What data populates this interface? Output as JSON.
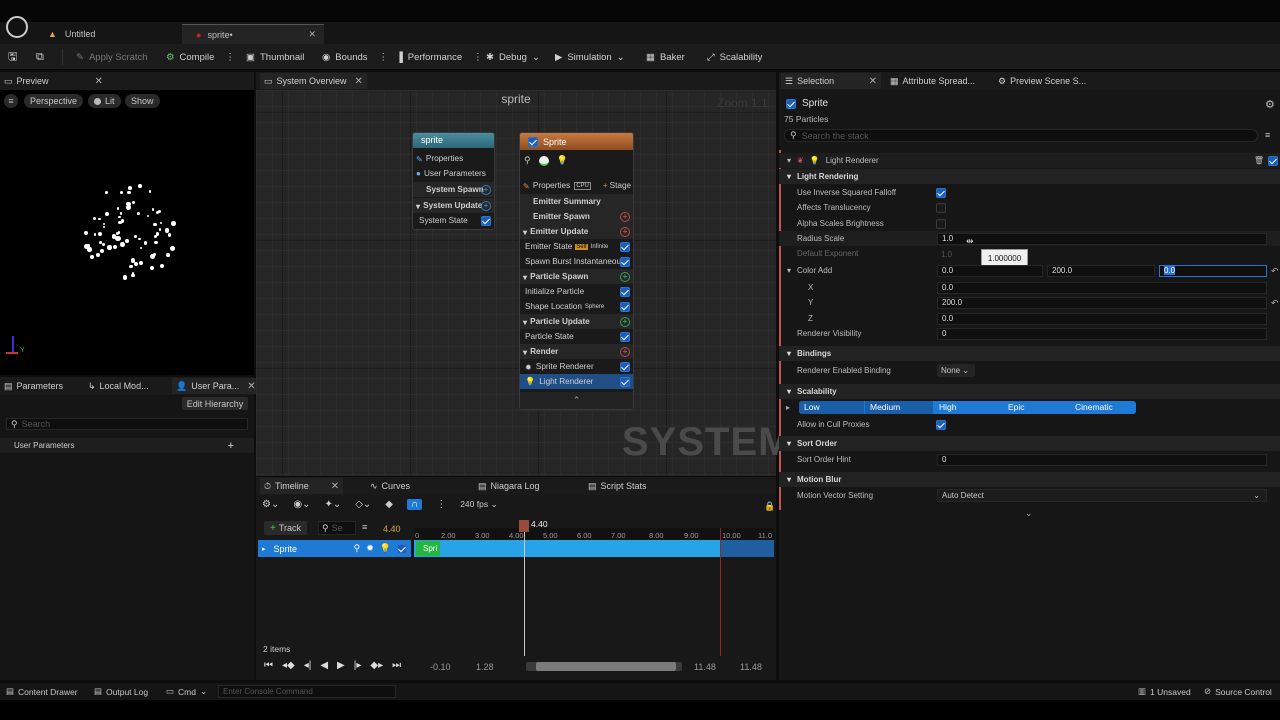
{
  "tabs": [
    {
      "label": "Untitled"
    },
    {
      "label": "sprite•"
    }
  ],
  "toolbar": {
    "apply_scratch": "Apply Scratch",
    "compile": "Compile",
    "thumbnail": "Thumbnail",
    "bounds": "Bounds",
    "performance": "Performance",
    "debug": "Debug",
    "simulation": "Simulation",
    "baker": "Baker",
    "scalability": "Scalability"
  },
  "preview": {
    "tab": "Preview",
    "perspective": "Perspective",
    "lit": "Lit",
    "show": "Show",
    "axis_y": "Y"
  },
  "params": {
    "tab_parameters": "Parameters",
    "tab_local": "Local Mod...",
    "tab_user": "User Para...",
    "edit_hierarchy": "Edit Hierarchy",
    "search_placeholder": "Search",
    "user_parameters": "User Parameters"
  },
  "overview": {
    "tab": "System Overview",
    "title": "sprite",
    "zoom": "Zoom 1:1",
    "watermark": "SYSTEM",
    "system_node": {
      "title": "sprite",
      "rows": [
        "Properties",
        "User Parameters",
        "System Spawn",
        "System Update",
        "System State"
      ]
    },
    "emitter_node": {
      "title": "Sprite",
      "properties": "Properties",
      "cpu": "CPU",
      "stage": "Stage",
      "emitter_summary": "Emitter Summary",
      "emitter_spawn": "Emitter Spawn",
      "emitter_update": "Emitter Update",
      "emitter_state": "Emitter State",
      "self": "Self",
      "infinite": "Infinite",
      "spawn_burst": "Spawn Burst Instantaneous",
      "particle_spawn": "Particle Spawn",
      "initialize_particle": "Initialize Particle",
      "shape_location": "Shape Location",
      "sphere": "Sphere",
      "particle_update": "Particle Update",
      "particle_state": "Particle State",
      "render": "Render",
      "sprite_renderer": "Sprite Renderer",
      "light_renderer": "Light Renderer"
    }
  },
  "timeline": {
    "tabs": [
      "Timeline",
      "Curves",
      "Niagara Log",
      "Script Stats"
    ],
    "fps": "240 fps",
    "track_button": "Track",
    "search_placeholder": "Se",
    "current_time": "4.40",
    "playhead_label": "4.40",
    "track_name": "Sprite",
    "bar_label": "Spri",
    "ticks": [
      "0",
      "2.00",
      "3.00",
      "4.00",
      "5.00",
      "6.00",
      "7.00",
      "8.00",
      "9.00",
      "10.00",
      "11.0"
    ],
    "items_count": "2 items",
    "range_start": "-0.10",
    "range_left": "1.28",
    "range_right": "11.48",
    "range_end": "11.48"
  },
  "selection": {
    "tab": "Selection",
    "tab_attr": "Attribute Spread...",
    "tab_preview": "Preview Scene S...",
    "name": "Sprite",
    "particles": "75 Particles",
    "search_placeholder": "Search the stack",
    "module": "Light Renderer",
    "sections": {
      "light_rendering": "Light Rendering",
      "bindings": "Bindings",
      "scalability": "Scalability",
      "sort_order": "Sort Order",
      "motion_blur": "Motion Blur"
    },
    "props": {
      "use_inverse": "Use Inverse Squared Falloff",
      "affects_translucency": "Affects Translucency",
      "alpha_scales": "Alpha Scales Brightness",
      "radius_scale": "Radius Scale",
      "radius_scale_value": "1.0",
      "tooltip": "1.000000",
      "default_exponent": "Default Exponent",
      "default_exponent_value": "1.0",
      "color_add": "Color Add",
      "color_add_x": "0.0",
      "color_add_y": "200.0",
      "color_add_z": "0.0",
      "x": "X",
      "x_value": "0.0",
      "y": "Y",
      "y_value": "200.0",
      "z": "Z",
      "z_value": "0.0",
      "renderer_visibility": "Renderer Visibility",
      "renderer_visibility_value": "0",
      "renderer_enabled_binding": "Renderer Enabled Binding",
      "none": "None",
      "scal_levels": [
        "Low",
        "Medium",
        "High",
        "Epic",
        "Cinematic"
      ],
      "allow_cull": "Allow in Cull Proxies",
      "sort_order_hint": "Sort Order Hint",
      "sort_order_value": "0",
      "motion_vector": "Motion Vector Setting",
      "auto_detect": "Auto Detect"
    }
  },
  "statusbar": {
    "content_drawer": "Content Drawer",
    "output_log": "Output Log",
    "cmd": "Cmd",
    "console_placeholder": "Enter Console Command",
    "unsaved": "1 Unsaved",
    "source_control": "Source Control"
  }
}
